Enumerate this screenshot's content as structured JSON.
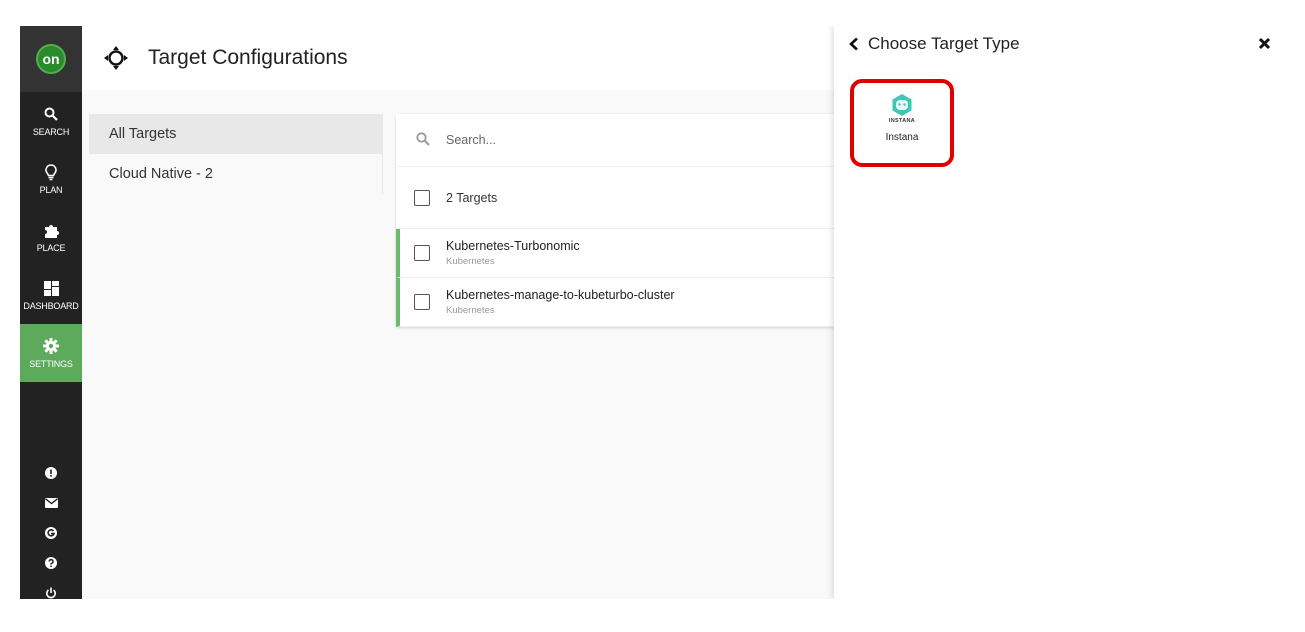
{
  "nav": {
    "logo": "on",
    "items": [
      {
        "label": "SEARCH",
        "icon": "search-icon"
      },
      {
        "label": "PLAN",
        "icon": "lightbulb-icon"
      },
      {
        "label": "PLACE",
        "icon": "puzzle-icon"
      },
      {
        "label": "DASHBOARD",
        "icon": "dashboard-icon"
      },
      {
        "label": "SETTINGS",
        "icon": "gear-icon"
      }
    ],
    "bottom_icons": [
      "alert-icon",
      "mail-icon",
      "g-icon",
      "help-icon",
      "power-icon"
    ],
    "active_color": "#5daa5d"
  },
  "header": {
    "title": "Target Configurations",
    "icon": "crosshair-icon"
  },
  "filters": [
    {
      "label": "All Targets",
      "active": true
    },
    {
      "label": "Cloud Native - 2",
      "active": false
    }
  ],
  "targets": {
    "search_placeholder": "Search...",
    "count_label": "2 Targets",
    "rows": [
      {
        "name": "Kubernetes-Turbonomic",
        "type": "Kubernetes"
      },
      {
        "name": "Kubernetes-manage-to-kubeturbo-cluster",
        "type": "Kubernetes"
      }
    ],
    "status_color": "#6cbb6c"
  },
  "panel": {
    "title": "Choose Target Type",
    "back_icon": "chevron-left-icon",
    "close_icon": "close-icon",
    "tiles": [
      {
        "name": "Instana",
        "brand": "INSTANA",
        "icon": "instana-logo-icon",
        "highlight_color": "#e00000"
      }
    ]
  }
}
